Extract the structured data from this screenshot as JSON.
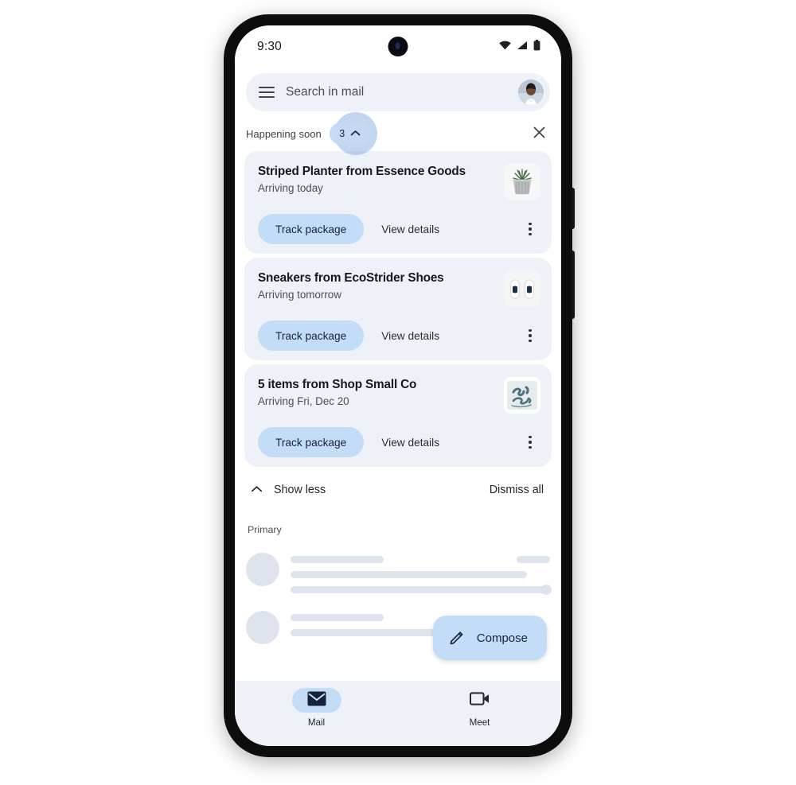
{
  "status_bar": {
    "time": "9:30",
    "icons": [
      "wifi-icon",
      "signal-icon",
      "battery-icon"
    ]
  },
  "search": {
    "placeholder": "Search in mail",
    "menu_icon": "hamburger-menu-icon",
    "avatar_alt": "account-avatar"
  },
  "happening_soon": {
    "title": "Happening soon",
    "count": "3",
    "expand_icon": "chevron-up-icon",
    "close_icon": "close-x-icon"
  },
  "packages": [
    {
      "title": "Striped Planter from Essence Goods",
      "subtitle": "Arriving today",
      "thumb": "planter-thumbnail",
      "track_label": "Track package",
      "view_label": "View details",
      "menu_icon": "more-options-icon"
    },
    {
      "title": "Sneakers from EcoStrider Shoes",
      "subtitle": "Arriving tomorrow",
      "thumb": "sneakers-thumbnail",
      "track_label": "Track package",
      "view_label": "View details",
      "menu_icon": "more-options-icon"
    },
    {
      "title": "5 items from Shop Small Co",
      "subtitle": "Arriving Fri, Dec 20",
      "thumb": "shop-small-logo-thumbnail",
      "track_label": "Track package",
      "view_label": "View details",
      "menu_icon": "more-options-icon"
    }
  ],
  "footer_actions": {
    "show_less": "Show less",
    "show_less_icon": "chevron-up-icon",
    "dismiss_all": "Dismiss all"
  },
  "inbox": {
    "section_label": "Primary"
  },
  "compose": {
    "label": "Compose",
    "icon": "pencil-edit-icon"
  },
  "bottom_nav": [
    {
      "label": "Mail",
      "icon": "envelope-icon",
      "active": true
    },
    {
      "label": "Meet",
      "icon": "video-camera-icon",
      "active": false
    }
  ],
  "colors": {
    "accent_blue": "#c3dcf8",
    "surface": "#eef1f8",
    "on_surface": "#17181a",
    "secondary_text": "#4b4e54",
    "skeleton": "#dfe3ee",
    "frame": "#0d0d0d"
  }
}
